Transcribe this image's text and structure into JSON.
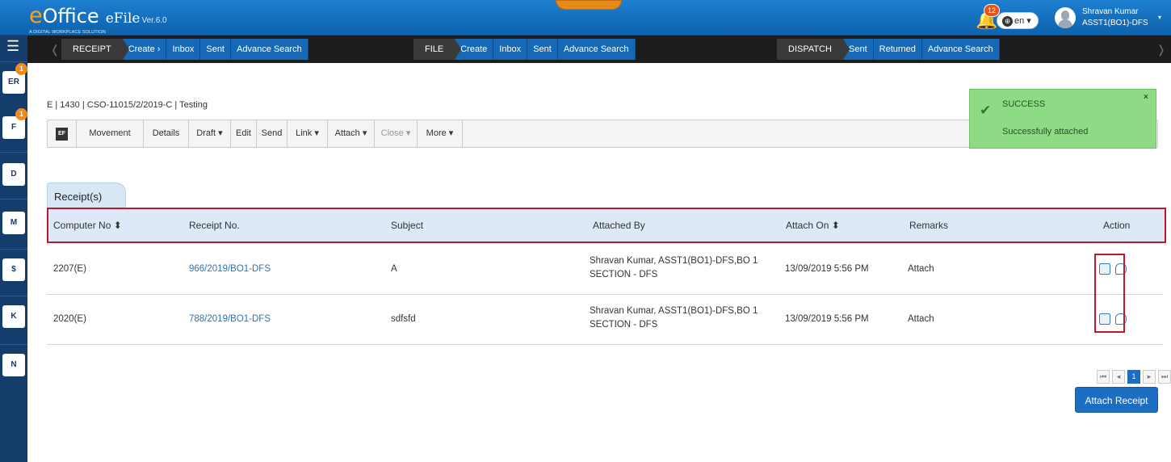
{
  "header": {
    "logo_e": "e",
    "logo_ffice": "Office",
    "logo_efile": "eFile",
    "version": "Ver.6.0",
    "tagline": "A DIGITAL WORKPLACE SOLUTION",
    "notifications": "12",
    "language": "en",
    "user_name": "Shravan Kumar",
    "user_role": "ASST1(BO1)-DFS",
    "brand_color": "#1569b7",
    "accent_color": "#f7a21b"
  },
  "sidebar": {
    "items": [
      {
        "icon": "receipt-icon",
        "label": "ER",
        "badge": "1"
      },
      {
        "icon": "file-icon",
        "label": "F",
        "badge": "1"
      },
      {
        "icon": "dispatch-icon",
        "label": "D"
      },
      {
        "icon": "movement-icon",
        "label": "M"
      },
      {
        "icon": "vip-icon",
        "label": "$"
      },
      {
        "icon": "knowledge-icon",
        "label": "K"
      },
      {
        "icon": "notings-icon",
        "label": "N"
      }
    ]
  },
  "nav": {
    "receipt": {
      "label": "RECEIPT",
      "items": [
        "Create ›",
        "Inbox",
        "Sent",
        "Advance Search"
      ]
    },
    "file": {
      "label": "FILE",
      "items": [
        "Create",
        "Inbox",
        "Sent",
        "Advance Search"
      ]
    },
    "dispatch": {
      "label": "DISPATCH",
      "items": [
        "Sent",
        "Returned",
        "Advance Search"
      ]
    }
  },
  "breadcrumb": "E | 1430 | CSO-11015/2/2019-C | Testing",
  "toolbar": {
    "efile_icon": "EF",
    "movement": "Movement",
    "details": "Details",
    "draft": "Draft ▾",
    "edit": "Edit",
    "send": "Send",
    "link": "Link ▾",
    "attach": "Attach ▾",
    "close": "Close ▾",
    "more": "More ▾"
  },
  "toast": {
    "title": "SUCCESS",
    "message": "Successfully attached",
    "close": "×",
    "check": "✔"
  },
  "receipts_tab": "Receipt(s)",
  "table": {
    "headers": {
      "computer_no": "Computer No ⬍",
      "receipt_no": "Receipt No.",
      "subject": "Subject",
      "attached_by": "Attached By",
      "attach_on": "Attach On ⬍",
      "remarks": "Remarks",
      "action": "Action"
    },
    "rows": [
      {
        "computer_no": "2207(E)",
        "receipt_no": "966/2019/BO1-DFS",
        "subject": "A",
        "attached_by_1": "Shravan Kumar, ASST1(BO1)-DFS,BO 1",
        "attached_by_2": "SECTION - DFS",
        "attach_on": "13/09/2019 5:56 PM",
        "remarks": "Attach"
      },
      {
        "computer_no": "2020(E)",
        "receipt_no": "788/2019/BO1-DFS",
        "subject": "sdfsfd",
        "attached_by_1": "Shravan Kumar, ASST1(BO1)-DFS,BO 1",
        "attached_by_2": "SECTION - DFS",
        "attach_on": "13/09/2019 5:56 PM",
        "remarks": "Attach"
      }
    ]
  },
  "pager": {
    "first": "⏮",
    "prev": "◂",
    "page": "1",
    "next": "▸",
    "last": "⏭"
  },
  "attach_receipt_button": "Attach Receipt"
}
